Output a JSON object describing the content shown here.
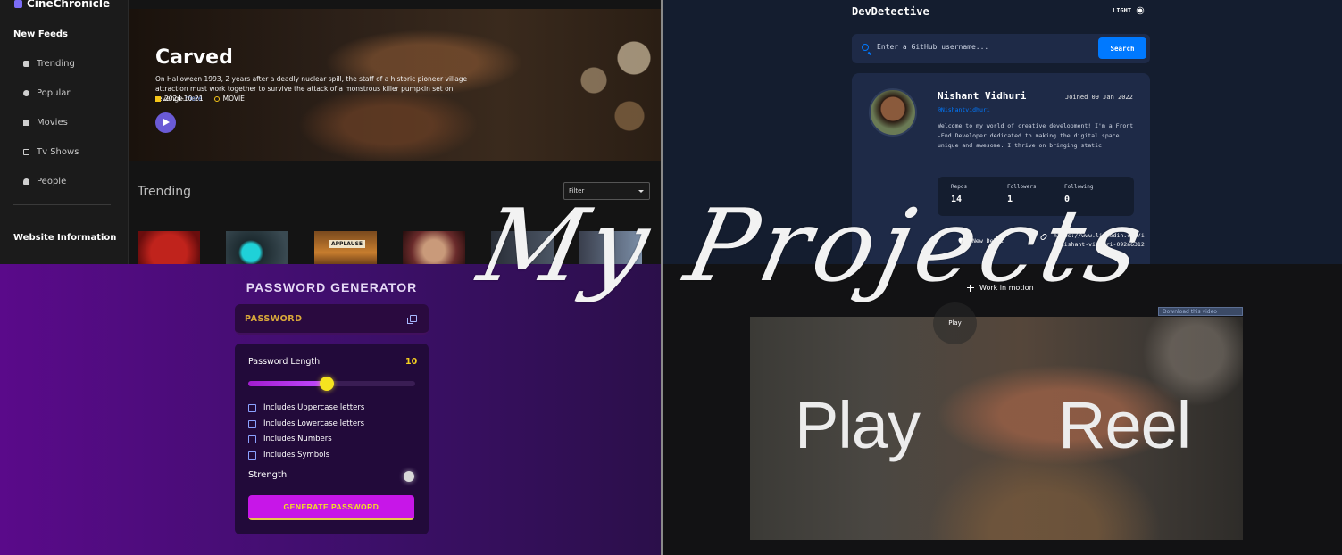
{
  "overlay": {
    "title": "My Projects"
  },
  "cinechronicle": {
    "brand": "CineChronicle",
    "section_feeds": "New Feeds",
    "nav": [
      {
        "label": "Trending",
        "icon": "fire-icon"
      },
      {
        "label": "Popular",
        "icon": "globe-icon"
      },
      {
        "label": "Movies",
        "icon": "film-icon"
      },
      {
        "label": "Tv Shows",
        "icon": "tv-icon"
      },
      {
        "label": "People",
        "icon": "person-icon"
      }
    ],
    "section_info": "Website Information",
    "hero": {
      "title": "Carved",
      "description": "On Halloween 1993, 2 years after a deadly nuclear spill, the staff of a historic pioneer village attraction must work together to survive the attack of a monstrous killer pumpkin set on revenge.",
      "more": "more",
      "date": "2024-10-21",
      "type": "MOVIE"
    },
    "trending_heading": "Trending",
    "filter_label": "Filter",
    "thumb_caption": "APPLAUSE"
  },
  "devdetective": {
    "title": "DevDetective",
    "mode_label": "LIGHT",
    "search_placeholder": "Enter a GitHub username...",
    "search_button": "Search",
    "user": {
      "name": "Nishant Vidhuri",
      "joined": "Joined 09 Jan 2022",
      "handle": "@Nishantvidhuri",
      "bio": "Welcome to my world of creative development! I'm a Front -End Developer dedicated to making the digital space unique and awesome. I thrive on bringing static",
      "stats": [
        {
          "label": "Repos",
          "value": "14"
        },
        {
          "label": "Followers",
          "value": "1"
        },
        {
          "label": "Following",
          "value": "0"
        }
      ],
      "location": "New Delhi",
      "link": "https://www.linkedin.com/in/nishant-vidhuri-092a63124/"
    }
  },
  "password_generator": {
    "title": "PASSWORD GENERATOR",
    "display_placeholder": "PASSWORD",
    "length_label": "Password Length",
    "length_value": "10",
    "slider_fraction": 0.47,
    "options": [
      "Includes Uppercase letters",
      "Includes Lowercase letters",
      "Includes Numbers",
      "Includes Symbols"
    ],
    "strength_label": "Strength",
    "generate_button": "GENERATE PASSWORD"
  },
  "play_reel": {
    "tagline": "Work in motion",
    "play_label": "Play",
    "download_label": "Download this video",
    "word_left": "Play",
    "word_right": "Reel"
  }
}
